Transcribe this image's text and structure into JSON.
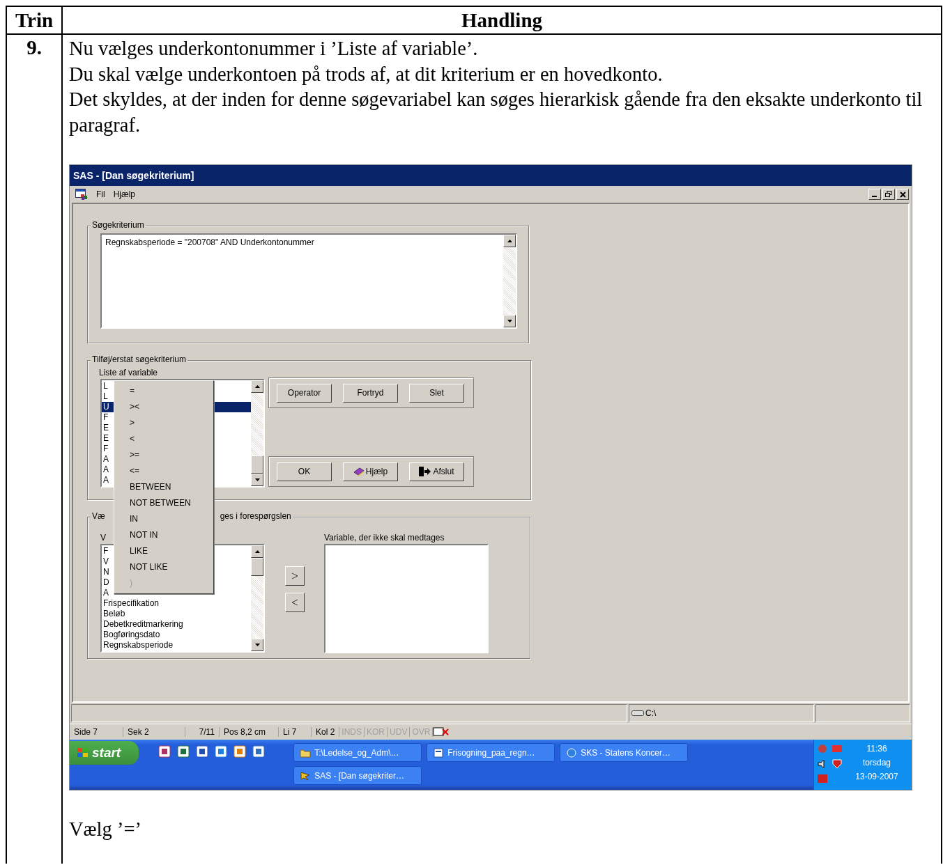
{
  "table": {
    "columns": [
      "Trin",
      "Handling"
    ]
  },
  "step": {
    "number": "9.",
    "paragraphs": [
      "Nu vælges underkontonummer i ’Liste af variable’.",
      "Du skal vælge underkontoen på trods af, at dit kriterium er en hovedkonto.",
      "Det skyldes, at der inden for denne søgevariabel kan søges hierarkisk gående fra den eksakte underkonto til paragraf."
    ],
    "instruction": "Vælg ’=’"
  },
  "screenshot": {
    "window": {
      "title": "SAS - [Dan søgekriterium]",
      "menu": [
        "Fil",
        "Hjælp"
      ]
    },
    "search_group": {
      "legend": "Søgekriterium",
      "text": "Regnskabsperiode = \"200708\" AND Underkontonummer"
    },
    "edit_group": {
      "legend": "Tilføj/erstat søgekriterium",
      "list_label": "Liste af variable",
      "list_items": [
        {
          "text": "L",
          "selected": false
        },
        {
          "text": "L",
          "selected": false
        },
        {
          "text": "U",
          "selected": true
        },
        {
          "text": "F",
          "selected": false
        },
        {
          "text": "E",
          "selected": false
        },
        {
          "text": "E",
          "selected": false
        },
        {
          "text": "F",
          "selected": false
        },
        {
          "text": "A",
          "selected": false
        },
        {
          "text": "A",
          "selected": false
        },
        {
          "text": "A",
          "selected": false
        }
      ],
      "top_buttons": [
        {
          "label": "Operator"
        },
        {
          "label": "Fortryd"
        },
        {
          "label": "Slet"
        }
      ],
      "bottom_buttons": [
        {
          "label": "OK"
        },
        {
          "label": "Hjælp",
          "kind": "help"
        },
        {
          "label": "Afslut",
          "kind": "exit"
        }
      ]
    },
    "select_group": {
      "legend_parts": [
        "Væ",
        "ges i forespørgslen"
      ],
      "left_label": "V",
      "left_items": [
        "F",
        "V",
        "N",
        "D",
        "A",
        "Frispecifikation",
        "Beløb",
        "Debetkreditmarkering",
        "Bogføringsdato",
        "Regnskabsperiode"
      ],
      "right_label": "Variable, der ikke skal medtages"
    },
    "operator_menu": [
      {
        "label": "=",
        "disabled": false
      },
      {
        "label": "><",
        "disabled": false
      },
      {
        "label": ">",
        "disabled": false
      },
      {
        "label": "<",
        "disabled": false
      },
      {
        "label": ">=",
        "disabled": false
      },
      {
        "label": "<=",
        "disabled": false
      },
      {
        "label": "BETWEEN",
        "disabled": false
      },
      {
        "label": "NOT BETWEEN",
        "disabled": false
      },
      {
        "label": "IN",
        "disabled": false
      },
      {
        "label": "NOT IN",
        "disabled": false
      },
      {
        "label": "LIKE",
        "disabled": false
      },
      {
        "label": "NOT LIKE",
        "disabled": false
      },
      {
        "label": ")",
        "disabled": true
      }
    ],
    "status_bar": {
      "drive": "C:\\"
    },
    "word_status": [
      {
        "text": "Side 7",
        "disabled": false
      },
      {
        "text": "Sek 2",
        "disabled": false
      },
      {
        "text": "7/11",
        "disabled": false
      },
      {
        "text": "Pos 8,2 cm",
        "disabled": false
      },
      {
        "text": "Li 7",
        "disabled": false
      },
      {
        "text": "Kol 2",
        "disabled": false
      },
      {
        "text": "INDS",
        "disabled": true
      },
      {
        "text": "KOR",
        "disabled": true
      },
      {
        "text": "UDV",
        "disabled": true
      },
      {
        "text": "OVR",
        "disabled": true
      }
    ],
    "taskbar": {
      "start": "start",
      "tasks": [
        {
          "label": "T:\\Ledelse_og_Adm\\…",
          "kind": "folder",
          "active": false
        },
        {
          "label": "Frisogning_paa_regn…",
          "kind": "word",
          "active": false
        },
        {
          "label": "SKS - Statens Koncer…",
          "kind": "browser",
          "active": false
        },
        {
          "label": "SAS - [Dan søgekriter…",
          "kind": "sas",
          "active": false
        }
      ],
      "clock": {
        "time": "11:36",
        "day": "torsdag",
        "date": "13-09-2007"
      }
    }
  }
}
